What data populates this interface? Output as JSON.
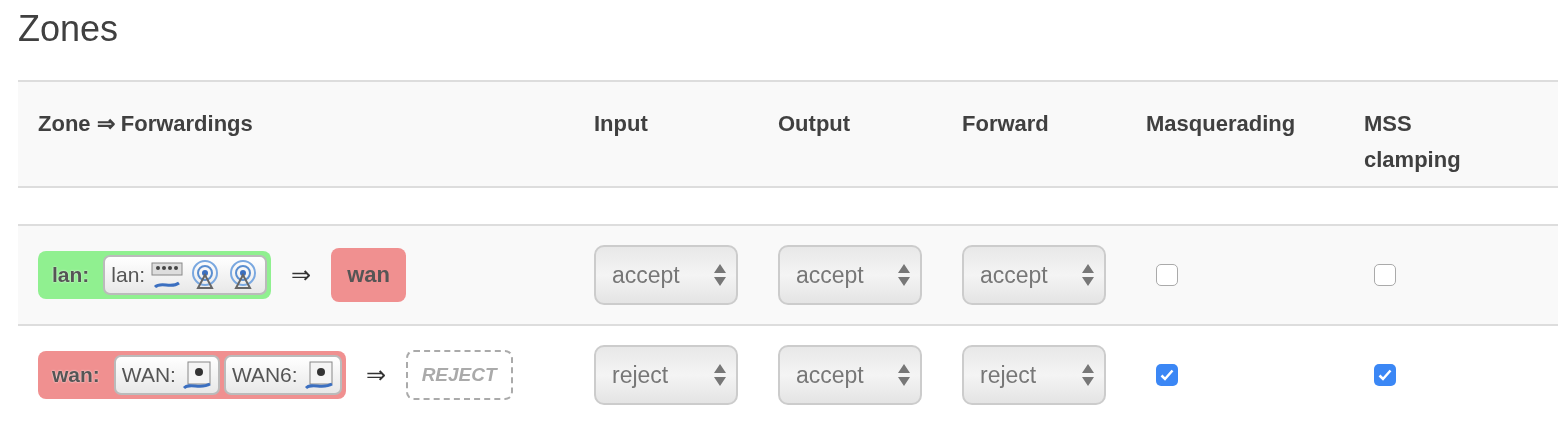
{
  "title": "Zones",
  "columns": [
    "Zone ⇒ Forwardings",
    "Input",
    "Output",
    "Forward",
    "Masquerading",
    "MSS clamping"
  ],
  "zones": [
    {
      "name": "lan:",
      "color": "#90f090",
      "networks": [
        {
          "label": "lan:",
          "devices": [
            {
              "kind": "switch"
            },
            {
              "kind": "wireless"
            },
            {
              "kind": "wireless"
            }
          ]
        }
      ],
      "arrow": "⇒",
      "forwardings": [
        {
          "kind": "zone",
          "label": "wan",
          "color": "#f09090"
        }
      ],
      "input": "accept",
      "output": "accept",
      "forward": "accept",
      "masquerading": false,
      "mss_clamping": false
    },
    {
      "name": "wan:",
      "color": "#f09090",
      "networks": [
        {
          "label": "WAN:",
          "devices": [
            {
              "kind": "port"
            }
          ]
        },
        {
          "label": "WAN6:",
          "devices": [
            {
              "kind": "port"
            }
          ]
        }
      ],
      "arrow": "⇒",
      "forwardings": [
        {
          "kind": "reject",
          "label": "REJECT"
        }
      ],
      "input": "reject",
      "output": "accept",
      "forward": "reject",
      "masquerading": true,
      "mss_clamping": true
    }
  ]
}
